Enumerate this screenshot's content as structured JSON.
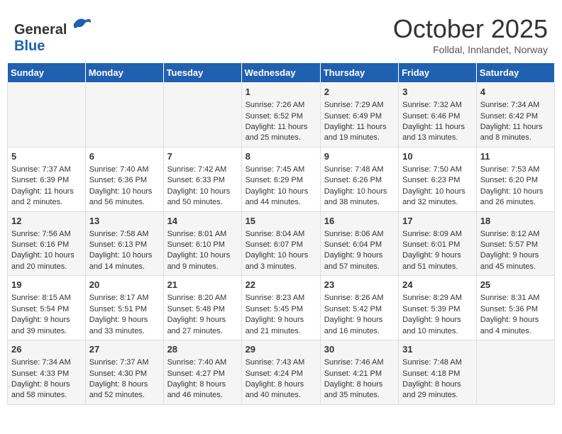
{
  "header": {
    "logo_line1": "General",
    "logo_line2": "Blue",
    "month_title": "October 2025",
    "location": "Folldal, Innlandet, Norway"
  },
  "days_of_week": [
    "Sunday",
    "Monday",
    "Tuesday",
    "Wednesday",
    "Thursday",
    "Friday",
    "Saturday"
  ],
  "weeks": [
    [
      {
        "day": "",
        "info": ""
      },
      {
        "day": "",
        "info": ""
      },
      {
        "day": "",
        "info": ""
      },
      {
        "day": "1",
        "info": "Sunrise: 7:26 AM\nSunset: 6:52 PM\nDaylight: 11 hours and 25 minutes."
      },
      {
        "day": "2",
        "info": "Sunrise: 7:29 AM\nSunset: 6:49 PM\nDaylight: 11 hours and 19 minutes."
      },
      {
        "day": "3",
        "info": "Sunrise: 7:32 AM\nSunset: 6:46 PM\nDaylight: 11 hours and 13 minutes."
      },
      {
        "day": "4",
        "info": "Sunrise: 7:34 AM\nSunset: 6:42 PM\nDaylight: 11 hours and 8 minutes."
      }
    ],
    [
      {
        "day": "5",
        "info": "Sunrise: 7:37 AM\nSunset: 6:39 PM\nDaylight: 11 hours and 2 minutes."
      },
      {
        "day": "6",
        "info": "Sunrise: 7:40 AM\nSunset: 6:36 PM\nDaylight: 10 hours and 56 minutes."
      },
      {
        "day": "7",
        "info": "Sunrise: 7:42 AM\nSunset: 6:33 PM\nDaylight: 10 hours and 50 minutes."
      },
      {
        "day": "8",
        "info": "Sunrise: 7:45 AM\nSunset: 6:29 PM\nDaylight: 10 hours and 44 minutes."
      },
      {
        "day": "9",
        "info": "Sunrise: 7:48 AM\nSunset: 6:26 PM\nDaylight: 10 hours and 38 minutes."
      },
      {
        "day": "10",
        "info": "Sunrise: 7:50 AM\nSunset: 6:23 PM\nDaylight: 10 hours and 32 minutes."
      },
      {
        "day": "11",
        "info": "Sunrise: 7:53 AM\nSunset: 6:20 PM\nDaylight: 10 hours and 26 minutes."
      }
    ],
    [
      {
        "day": "12",
        "info": "Sunrise: 7:56 AM\nSunset: 6:16 PM\nDaylight: 10 hours and 20 minutes."
      },
      {
        "day": "13",
        "info": "Sunrise: 7:58 AM\nSunset: 6:13 PM\nDaylight: 10 hours and 14 minutes."
      },
      {
        "day": "14",
        "info": "Sunrise: 8:01 AM\nSunset: 6:10 PM\nDaylight: 10 hours and 9 minutes."
      },
      {
        "day": "15",
        "info": "Sunrise: 8:04 AM\nSunset: 6:07 PM\nDaylight: 10 hours and 3 minutes."
      },
      {
        "day": "16",
        "info": "Sunrise: 8:06 AM\nSunset: 6:04 PM\nDaylight: 9 hours and 57 minutes."
      },
      {
        "day": "17",
        "info": "Sunrise: 8:09 AM\nSunset: 6:01 PM\nDaylight: 9 hours and 51 minutes."
      },
      {
        "day": "18",
        "info": "Sunrise: 8:12 AM\nSunset: 5:57 PM\nDaylight: 9 hours and 45 minutes."
      }
    ],
    [
      {
        "day": "19",
        "info": "Sunrise: 8:15 AM\nSunset: 5:54 PM\nDaylight: 9 hours and 39 minutes."
      },
      {
        "day": "20",
        "info": "Sunrise: 8:17 AM\nSunset: 5:51 PM\nDaylight: 9 hours and 33 minutes."
      },
      {
        "day": "21",
        "info": "Sunrise: 8:20 AM\nSunset: 5:48 PM\nDaylight: 9 hours and 27 minutes."
      },
      {
        "day": "22",
        "info": "Sunrise: 8:23 AM\nSunset: 5:45 PM\nDaylight: 9 hours and 21 minutes."
      },
      {
        "day": "23",
        "info": "Sunrise: 8:26 AM\nSunset: 5:42 PM\nDaylight: 9 hours and 16 minutes."
      },
      {
        "day": "24",
        "info": "Sunrise: 8:29 AM\nSunset: 5:39 PM\nDaylight: 9 hours and 10 minutes."
      },
      {
        "day": "25",
        "info": "Sunrise: 8:31 AM\nSunset: 5:36 PM\nDaylight: 9 hours and 4 minutes."
      }
    ],
    [
      {
        "day": "26",
        "info": "Sunrise: 7:34 AM\nSunset: 4:33 PM\nDaylight: 8 hours and 58 minutes."
      },
      {
        "day": "27",
        "info": "Sunrise: 7:37 AM\nSunset: 4:30 PM\nDaylight: 8 hours and 52 minutes."
      },
      {
        "day": "28",
        "info": "Sunrise: 7:40 AM\nSunset: 4:27 PM\nDaylight: 8 hours and 46 minutes."
      },
      {
        "day": "29",
        "info": "Sunrise: 7:43 AM\nSunset: 4:24 PM\nDaylight: 8 hours and 40 minutes."
      },
      {
        "day": "30",
        "info": "Sunrise: 7:46 AM\nSunset: 4:21 PM\nDaylight: 8 hours and 35 minutes."
      },
      {
        "day": "31",
        "info": "Sunrise: 7:48 AM\nSunset: 4:18 PM\nDaylight: 8 hours and 29 minutes."
      },
      {
        "day": "",
        "info": ""
      }
    ]
  ]
}
